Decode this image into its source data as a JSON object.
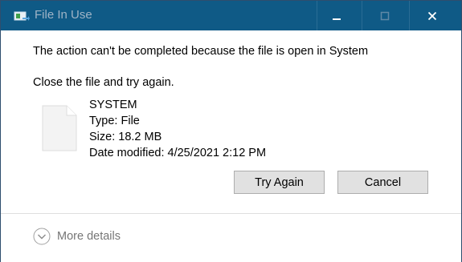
{
  "window": {
    "title": "File In Use"
  },
  "titlebar": {
    "minimize_icon": "minimize-icon",
    "maximize_icon": "maximize-icon",
    "close_icon": "close-icon"
  },
  "dialog": {
    "message": "The action can't be completed because the file is open in System",
    "instruction": "Close the file and try again.",
    "file": {
      "name": "SYSTEM",
      "type": "Type: File",
      "size": "Size: 18.2 MB",
      "modified": "Date modified: 4/25/2021 2:12 PM"
    },
    "buttons": {
      "try_again": "Try Again",
      "cancel": "Cancel"
    }
  },
  "footer": {
    "more_details": "More details"
  },
  "colors": {
    "titlebar": "#0f5a86",
    "button_bg": "#e1e1e1"
  }
}
